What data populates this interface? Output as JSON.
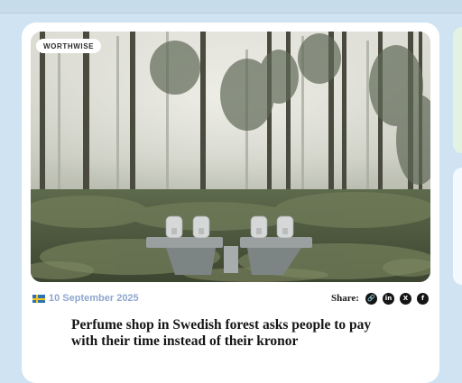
{
  "article": {
    "badge": "WORTHWISE",
    "date": "10 September 2025",
    "headline": "Perfume shop in Swedish forest asks people to pay with their time instead of their kronor",
    "image_alt": "Misty pine forest with a stone bench shop in the clearing"
  },
  "share": {
    "label": "Share:",
    "icons": [
      "link-icon",
      "linkedin-icon",
      "x-icon",
      "facebook-icon"
    ],
    "glyphs": [
      "🔗",
      "in",
      "X",
      "f"
    ]
  },
  "colors": {
    "date": "#8fa7cf",
    "page_bg": "#cfe3f2",
    "card_bg": "#ffffff"
  }
}
